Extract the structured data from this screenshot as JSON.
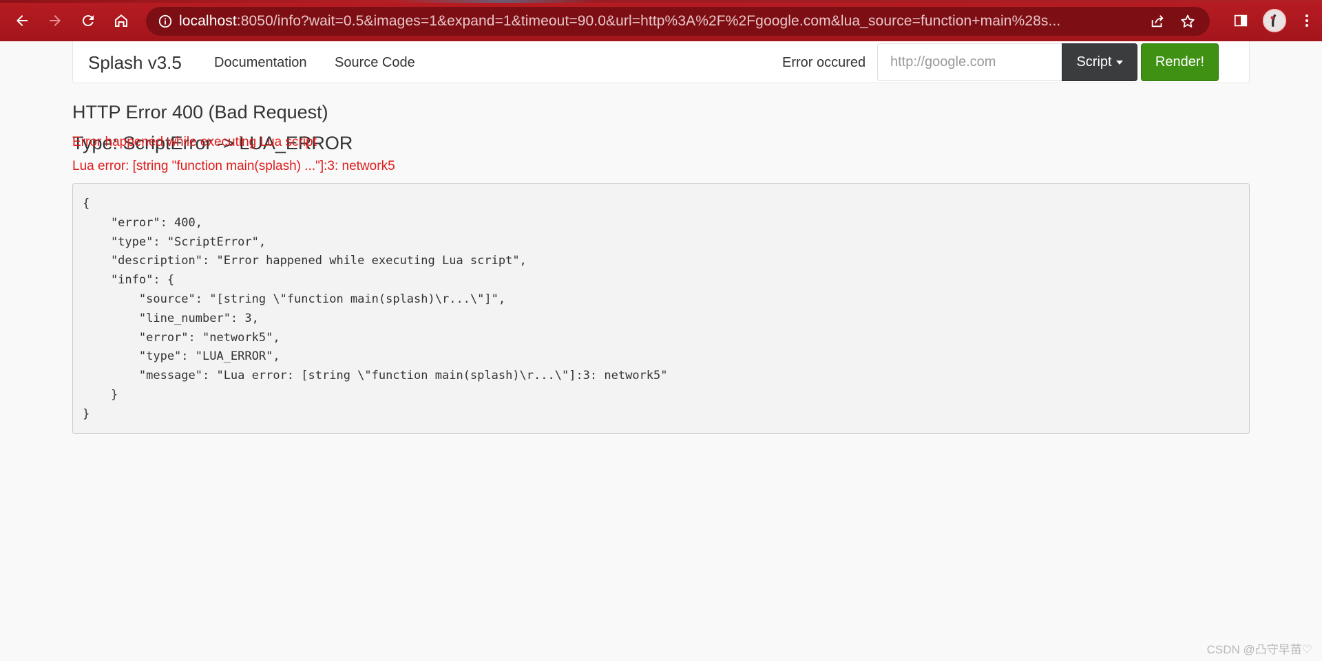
{
  "browser": {
    "url_host": "localhost",
    "url_rest": ":8050/info?wait=0.5&images=1&expand=1&timeout=90.0&url=http%3A%2F%2Fgoogle.com&lua_source=function+main%28s...",
    "theme_color": "#b71c22"
  },
  "navbar": {
    "brand": "Splash v3.5",
    "links": {
      "documentation": "Documentation",
      "source_code": "Source Code"
    },
    "status": "Error occured",
    "url_placeholder": "http://google.com",
    "script_button": "Script",
    "render_button": "Render!"
  },
  "error": {
    "title": "HTTP Error 400 (Bad Request)",
    "type": "Type: ScriptError -> LUA_ERROR",
    "description": "Error happened while executing Lua script",
    "lua_error": "Lua error: [string \"function main(splash) ...\"]:3: network5",
    "json": "{\n    \"error\": 400,\n    \"type\": \"ScriptError\",\n    \"description\": \"Error happened while executing Lua script\",\n    \"info\": {\n        \"source\": \"[string \\\"function main(splash)\\r...\\\"]\",\n        \"line_number\": 3,\n        \"error\": \"network5\",\n        \"type\": \"LUA_ERROR\",\n        \"message\": \"Lua error: [string \\\"function main(splash)\\r...\\\"]:3: network5\"\n    }\n}"
  },
  "watermark": "CSDN @凸守早苗♡",
  "icons": [
    "back-arrow-icon",
    "forward-arrow-icon",
    "reload-icon",
    "home-icon",
    "site-info-icon",
    "share-icon",
    "bookmark-star-icon",
    "side-panel-icon",
    "profile-avatar",
    "more-menu-icon"
  ]
}
